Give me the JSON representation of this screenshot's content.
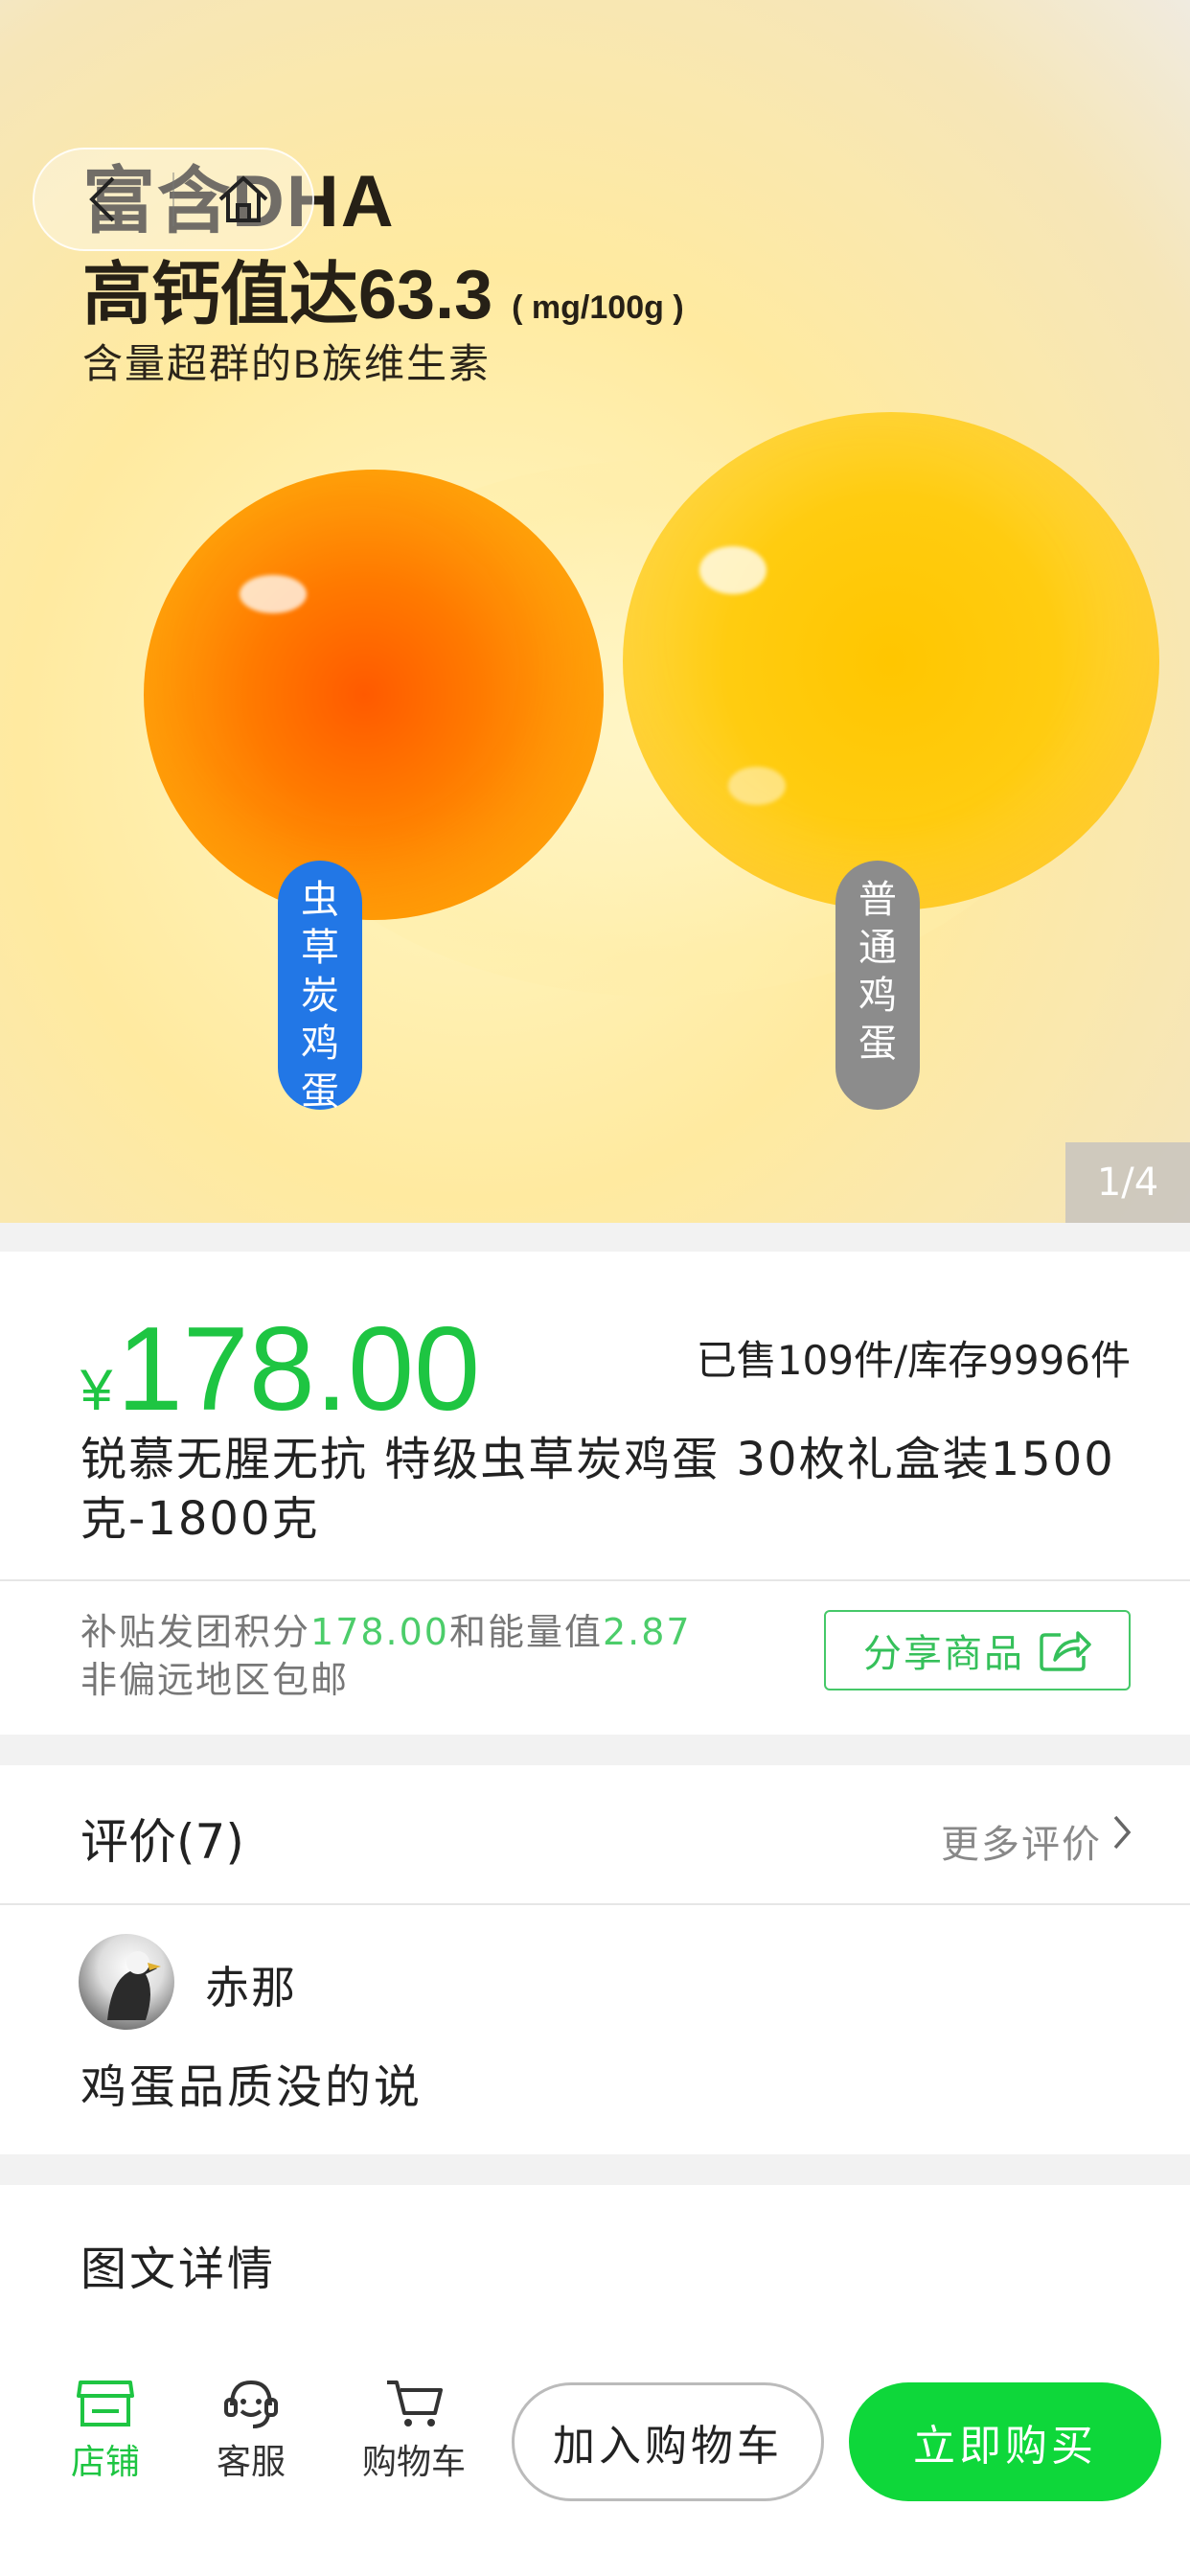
{
  "hero": {
    "headline_1": "富含DHA",
    "headline_2": "高钙值达63.3",
    "headline_2_unit": "( mg/100g )",
    "headline_3": "含量超群的B族维生素",
    "tag_left": [
      "虫",
      "草",
      "炭",
      "鸡",
      "蛋"
    ],
    "tag_right": [
      "普",
      "通",
      "鸡",
      "蛋"
    ],
    "counter": "1/4"
  },
  "nav": {
    "back_icon": "chevron-left-icon",
    "home_icon": "home-icon"
  },
  "product": {
    "currency": "¥",
    "price": "178.00",
    "sold_stock": "已售109件/库存9996件",
    "title": "锐慕无腥无抗 特级虫草炭鸡蛋 30枚礼盒装1500克-1800克"
  },
  "subsidy": {
    "prefix": "补贴发团积分",
    "points": "178.00",
    "middle": "和能量值",
    "energy": "2.87",
    "shipping": "非偏远地区包邮",
    "share_label": "分享商品"
  },
  "reviews": {
    "title": "评价(7)",
    "more": "更多评价",
    "items": [
      {
        "name": "赤那",
        "text": "鸡蛋品质没的说"
      }
    ]
  },
  "details": {
    "title": "图文详情"
  },
  "bottom_bar": {
    "store": "店铺",
    "service": "客服",
    "cart": "购物车",
    "add_to_cart": "加入购物车",
    "buy_now": "立即购买"
  },
  "colors": {
    "accent": "#1ec542",
    "buy_button": "#0ed73a",
    "tag_blue": "#2277e6",
    "tag_gray": "#8c8c8c"
  }
}
